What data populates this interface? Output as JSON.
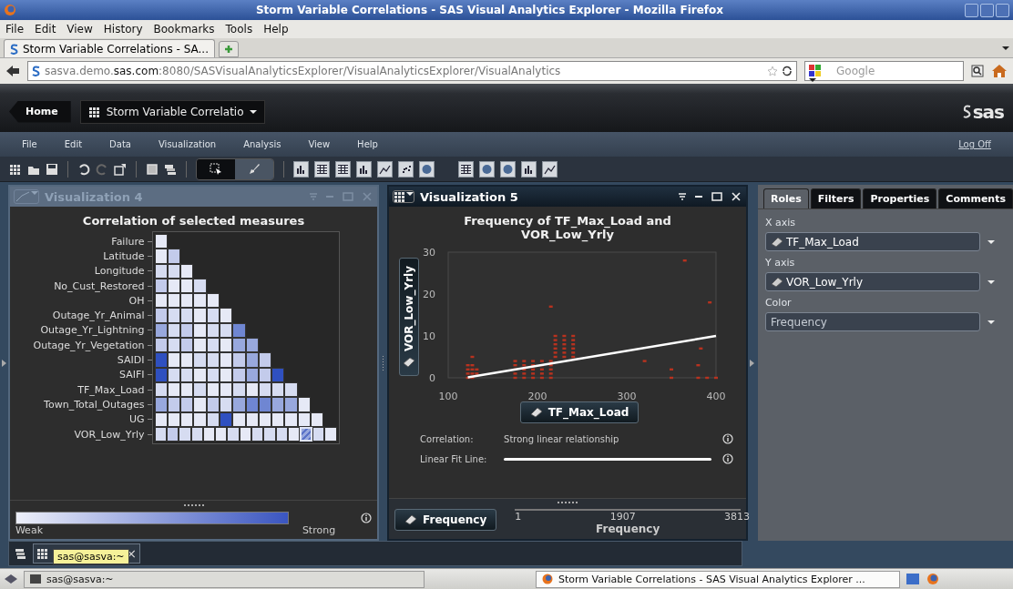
{
  "browser": {
    "title": "Storm Variable Correlations - SAS Visual Analytics Explorer - Mozilla Firefox",
    "menu": [
      "File",
      "Edit",
      "View",
      "History",
      "Bookmarks",
      "Tools",
      "Help"
    ],
    "tabs": [
      {
        "label": "Storm Variable Correlations - SA...",
        "selected": true
      }
    ],
    "address": "sasva.demo.**sas.com**:8080/SASVisualAnalyticsExplorer/VisualAnalyticsExplorer/VisualAnalytics",
    "search": {
      "placeholder": "Google"
    }
  },
  "app": {
    "home": "Home",
    "report": "Storm Variable Correlatio",
    "logo": "sas",
    "menu": [
      "File",
      "Edit",
      "Data",
      "Visualization",
      "Analysis",
      "View",
      "Help"
    ],
    "log_off": "Log Off",
    "modes": [
      {
        "kind": "select",
        "selected": true
      },
      {
        "kind": "brush",
        "selected": false
      }
    ]
  },
  "left_panel": {
    "title": "Visualization 4",
    "active": false,
    "chart_title": "Correlation of selected measures",
    "rows": [
      {
        "label": "Failure",
        "cells": [
          {
            "color": "#e6e9f6",
            "selected": false
          }
        ]
      },
      {
        "label": "Latitude",
        "cells": [
          {
            "color": "#e6e9f6",
            "selected": false
          },
          {
            "color": "#c3cbeb",
            "selected": false
          }
        ]
      },
      {
        "label": "Longitude",
        "cells": [
          {
            "color": "#d6dcf1",
            "selected": false
          },
          {
            "color": "#d6dcf1",
            "selected": false
          },
          {
            "color": "#e6e9f6",
            "selected": false
          }
        ]
      },
      {
        "label": "No_Cust_Restored",
        "cells": [
          {
            "color": "#c3cbeb",
            "selected": false
          },
          {
            "color": "#e6e9f6",
            "selected": false
          },
          {
            "color": "#e6e9f6",
            "selected": false
          },
          {
            "color": "#d6dcf1",
            "selected": false
          }
        ]
      },
      {
        "label": "OH",
        "cells": [
          {
            "color": "#e6e9f6",
            "selected": false
          },
          {
            "color": "#e6e9f6",
            "selected": false
          },
          {
            "color": "#e6e9f6",
            "selected": false
          },
          {
            "color": "#e6e9f6",
            "selected": false
          },
          {
            "color": "#e6e9f6",
            "selected": false
          }
        ]
      },
      {
        "label": "Outage_Yr_Animal",
        "cells": [
          {
            "color": "#c3cbeb",
            "selected": false
          },
          {
            "color": "#d6dcf1",
            "selected": false
          },
          {
            "color": "#d6dcf1",
            "selected": false
          },
          {
            "color": "#e6e9f6",
            "selected": false
          },
          {
            "color": "#d6dcf1",
            "selected": false
          },
          {
            "color": "#e6e9f6",
            "selected": false
          }
        ]
      },
      {
        "label": "Outage_Yr_Lightning",
        "cells": [
          {
            "color": "#98a8dd",
            "selected": false
          },
          {
            "color": "#d6dcf1",
            "selected": false
          },
          {
            "color": "#c3cbeb",
            "selected": false
          },
          {
            "color": "#e6e9f6",
            "selected": false
          },
          {
            "color": "#d6dcf1",
            "selected": false
          },
          {
            "color": "#d6dcf1",
            "selected": false
          },
          {
            "color": "#6f86d2",
            "selected": false
          }
        ]
      },
      {
        "label": "Outage_Yr_Vegetation",
        "cells": [
          {
            "color": "#c3cbeb",
            "selected": false
          },
          {
            "color": "#d6dcf1",
            "selected": false
          },
          {
            "color": "#c3cbeb",
            "selected": false
          },
          {
            "color": "#e6e9f6",
            "selected": false
          },
          {
            "color": "#d6dcf1",
            "selected": false
          },
          {
            "color": "#e6e9f6",
            "selected": false
          },
          {
            "color": "#98a8dd",
            "selected": false
          },
          {
            "color": "#98a8dd",
            "selected": false
          }
        ]
      },
      {
        "label": "SAIDI",
        "cells": [
          {
            "color": "#2f50c0",
            "selected": false
          },
          {
            "color": "#e6e9f6",
            "selected": false
          },
          {
            "color": "#e6e9f6",
            "selected": false
          },
          {
            "color": "#d6dcf1",
            "selected": false
          },
          {
            "color": "#d6dcf1",
            "selected": false
          },
          {
            "color": "#e6e9f6",
            "selected": false
          },
          {
            "color": "#c3cbeb",
            "selected": false
          },
          {
            "color": "#98a8dd",
            "selected": false
          },
          {
            "color": "#c3cbeb",
            "selected": false
          }
        ]
      },
      {
        "label": "SAIFI",
        "cells": [
          {
            "color": "#2f50c0",
            "selected": false
          },
          {
            "color": "#d6dcf1",
            "selected": false
          },
          {
            "color": "#d6dcf1",
            "selected": false
          },
          {
            "color": "#e6e9f6",
            "selected": false
          },
          {
            "color": "#d6dcf1",
            "selected": false
          },
          {
            "color": "#e6e9f6",
            "selected": false
          },
          {
            "color": "#c3cbeb",
            "selected": false
          },
          {
            "color": "#98a8dd",
            "selected": false
          },
          {
            "color": "#c3cbeb",
            "selected": false
          },
          {
            "color": "#2f50c0",
            "selected": false
          }
        ]
      },
      {
        "label": "TF_Max_Load",
        "cells": [
          {
            "color": "#d6dcf1",
            "selected": false
          },
          {
            "color": "#e6e9f6",
            "selected": false
          },
          {
            "color": "#e6e9f6",
            "selected": false
          },
          {
            "color": "#d6dcf1",
            "selected": false
          },
          {
            "color": "#e6e9f6",
            "selected": false
          },
          {
            "color": "#e6e9f6",
            "selected": false
          },
          {
            "color": "#d6dcf1",
            "selected": false
          },
          {
            "color": "#e6e9f6",
            "selected": false
          },
          {
            "color": "#d6dcf1",
            "selected": false
          },
          {
            "color": "#d6dcf1",
            "selected": false
          },
          {
            "color": "#d6dcf1",
            "selected": false
          }
        ]
      },
      {
        "label": "Town_Total_Outages",
        "cells": [
          {
            "color": "#98a8dd",
            "selected": false
          },
          {
            "color": "#c3cbeb",
            "selected": false
          },
          {
            "color": "#c3cbeb",
            "selected": false
          },
          {
            "color": "#e6e9f6",
            "selected": false
          },
          {
            "color": "#c3cbeb",
            "selected": false
          },
          {
            "color": "#d6dcf1",
            "selected": false
          },
          {
            "color": "#98a8dd",
            "selected": false
          },
          {
            "color": "#6f86d2",
            "selected": false
          },
          {
            "color": "#6f86d2",
            "selected": false
          },
          {
            "color": "#98a8dd",
            "selected": false
          },
          {
            "color": "#98a8dd",
            "selected": false
          },
          {
            "color": "#e6e9f6",
            "selected": false
          }
        ]
      },
      {
        "label": "UG",
        "cells": [
          {
            "color": "#e6e9f6",
            "selected": false
          },
          {
            "color": "#e6e9f6",
            "selected": false
          },
          {
            "color": "#e6e9f6",
            "selected": false
          },
          {
            "color": "#e6e9f6",
            "selected": false
          },
          {
            "color": "#d6dcf1",
            "selected": false
          },
          {
            "color": "#2f50c0",
            "selected": false
          },
          {
            "color": "#e6e9f6",
            "selected": false
          },
          {
            "color": "#e6e9f6",
            "selected": false
          },
          {
            "color": "#e6e9f6",
            "selected": false
          },
          {
            "color": "#e6e9f6",
            "selected": false
          },
          {
            "color": "#e6e9f6",
            "selected": false
          },
          {
            "color": "#e6e9f6",
            "selected": false
          },
          {
            "color": "#e6e9f6",
            "selected": false
          }
        ]
      },
      {
        "label": "VOR_Low_Yrly",
        "cells": [
          {
            "color": "#d6dcf1",
            "selected": false
          },
          {
            "color": "#c3cbeb",
            "selected": false
          },
          {
            "color": "#d6dcf1",
            "selected": false
          },
          {
            "color": "#d6dcf1",
            "selected": false
          },
          {
            "color": "#e6e9f6",
            "selected": false
          },
          {
            "color": "#e6e9f6",
            "selected": false
          },
          {
            "color": "#d6dcf1",
            "selected": false
          },
          {
            "color": "#e6e9f6",
            "selected": false
          },
          {
            "color": "#d6dcf1",
            "selected": false
          },
          {
            "color": "#d6dcf1",
            "selected": false
          },
          {
            "color": "#d6dcf1",
            "selected": false
          },
          {
            "color": "#e6e9f6",
            "selected": false
          },
          {
            "color": "#98a8dd",
            "selected": true
          },
          {
            "color": "#d6dcf1",
            "selected": false
          },
          {
            "color": "#e6e9f6",
            "selected": false
          }
        ]
      }
    ],
    "legend": {
      "low": "Weak",
      "high": "Strong"
    }
  },
  "middle_panel": {
    "title": "Visualization 5",
    "active": true,
    "chart_data": {
      "type": "scatter",
      "title": "Frequency of TF_Max_Load and VOR_Low_Yrly",
      "xlabel": "TF_Max_Load",
      "ylabel": "VOR_Low_Yrly",
      "xlim": [
        100,
        400
      ],
      "ylim": [
        0,
        30
      ],
      "xticks": [
        100,
        200,
        300,
        400
      ],
      "yticks": [
        0,
        10,
        20,
        30
      ],
      "x": [
        122,
        122,
        122,
        122,
        127,
        127,
        127,
        127,
        127,
        132,
        132,
        175,
        175,
        175,
        175,
        175,
        185,
        185,
        185,
        185,
        185,
        195,
        195,
        195,
        195,
        195,
        205,
        205,
        205,
        205,
        205,
        215,
        215,
        215,
        215,
        215,
        220,
        220,
        220,
        220,
        220,
        220,
        230,
        230,
        230,
        230,
        230,
        230,
        240,
        240,
        240,
        240,
        240,
        240,
        215,
        320,
        350,
        350,
        365,
        380,
        380,
        383,
        390,
        393,
        400
      ],
      "series": [
        {
          "name": "Frequency",
          "type": "scatter",
          "color": "#b8321f",
          "values": [
            0,
            1,
            2,
            3,
            0,
            1,
            2,
            3,
            5,
            1,
            2,
            0,
            1,
            2,
            3,
            4,
            0,
            1,
            2,
            3,
            4,
            0,
            1,
            2,
            3,
            4,
            0,
            1,
            2,
            3,
            4,
            0,
            1,
            2,
            3,
            4,
            5,
            6,
            7,
            8,
            9,
            10,
            5,
            6,
            7,
            8,
            9,
            10,
            5,
            6,
            7,
            8,
            9,
            10,
            17,
            4,
            0,
            2,
            28,
            0,
            3,
            7,
            0,
            18,
            0
          ]
        },
        {
          "name": "Linear Fit Line:",
          "type": "line",
          "color": "#ffffff",
          "values": [
            0.1,
            null,
            null,
            null,
            null,
            null,
            null,
            null,
            null,
            null,
            null,
            null,
            null,
            null,
            null,
            null,
            null,
            null,
            null,
            null,
            null,
            null,
            null,
            null,
            null,
            null,
            null,
            null,
            null,
            null,
            null,
            null,
            null,
            null,
            null,
            null,
            null,
            null,
            null,
            null,
            null,
            null,
            null,
            null,
            null,
            null,
            null,
            null,
            null,
            null,
            null,
            null,
            null,
            null,
            null,
            null,
            null,
            null,
            null,
            null,
            null,
            null,
            null,
            null,
            10
          ]
        }
      ]
    },
    "stats": [
      {
        "label": "Correlation:",
        "value": "Strong linear relationship"
      }
    ],
    "legend": {
      "role": "Frequency",
      "ticks": [
        "1",
        "1907",
        "3813"
      ]
    }
  },
  "right_panel": {
    "tabs": [
      {
        "label": "Roles",
        "selected": true
      },
      {
        "label": "Filters",
        "selected": false
      },
      {
        "label": "Properties",
        "selected": false
      },
      {
        "label": "Comments",
        "selected": false
      }
    ],
    "roles": [
      {
        "label": "X axis",
        "value": "TF_Max_Load",
        "measure": true
      },
      {
        "label": "Y axis",
        "value": "VOR_Low_Yrly",
        "measure": true
      },
      {
        "label": "Color",
        "value": "Frequency",
        "measure": false
      }
    ]
  },
  "dock": {
    "close": "×",
    "tooltip": "sas@sasva:~"
  },
  "taskbar": [
    {
      "label": "sas@sasva:~",
      "selected": false
    },
    {
      "label": "Storm Variable Correlations - SAS Visual Analytics Explorer ...",
      "selected": true
    }
  ]
}
